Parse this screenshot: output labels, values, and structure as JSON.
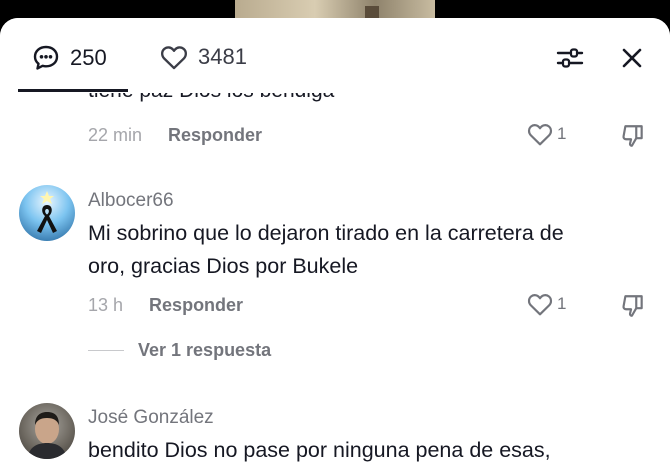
{
  "header": {
    "comment_count": "250",
    "like_count": "3481",
    "filter_icon": "sliders-icon",
    "close_icon": "close-icon"
  },
  "comments": [
    {
      "text": "tiene paz Dios los bendiga",
      "time": "22 min",
      "reply_label": "Responder",
      "likes": "1"
    },
    {
      "username": "Albocer66",
      "text_line1": "Mi sobrino que lo dejaron tirado en la carretera de",
      "text_line2": "oro, gracias Dios por Bukele",
      "time": "13 h",
      "reply_label": "Responder",
      "likes": "1",
      "view_replies": "Ver 1 respuesta"
    },
    {
      "username": "José González",
      "text": "bendito Dios no pase por ninguna pena de esas,"
    }
  ],
  "colors": {
    "primary_text": "#161823",
    "secondary_text": "#73757c",
    "muted_text": "#a5a6ab"
  }
}
